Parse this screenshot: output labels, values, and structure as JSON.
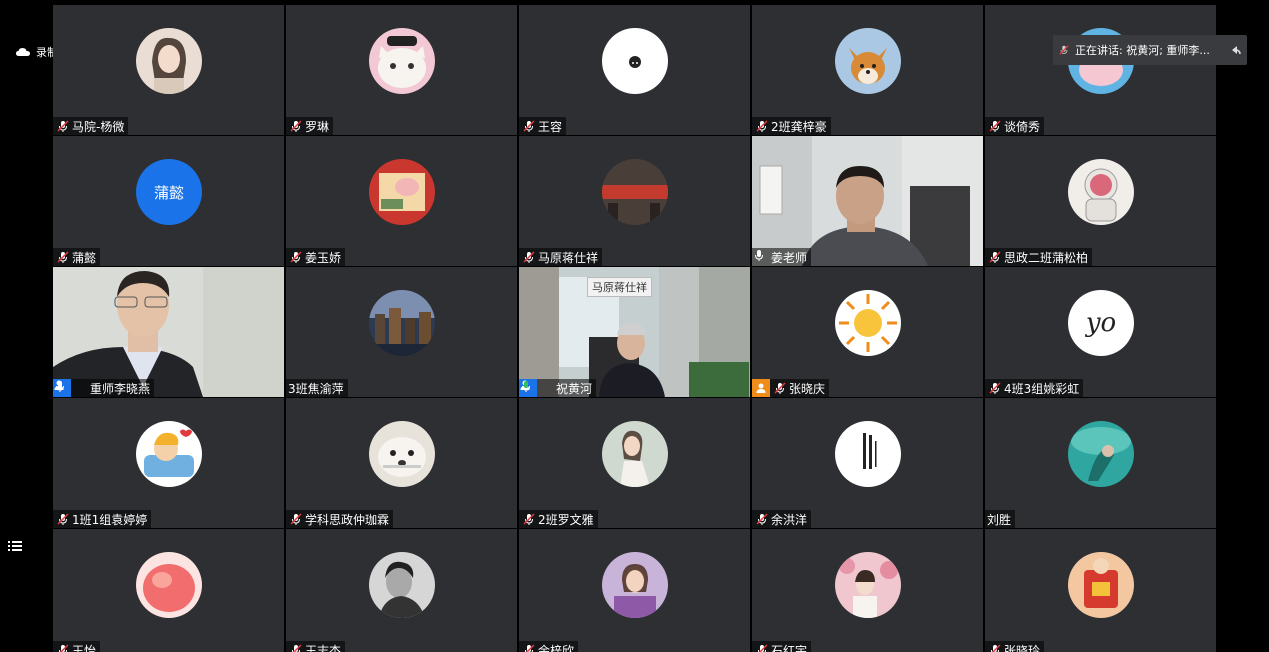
{
  "recording": {
    "label": "录制中"
  },
  "speaker_bar": {
    "text": "正在讲话: 祝黄河; 重师李..."
  },
  "participants": [
    {
      "name": "马院-杨微",
      "avatar": "photo-woman-icon"
    },
    {
      "name": "罗琳",
      "avatar": "cat-icon"
    },
    {
      "name": "王容",
      "avatar": "cartoon-face-icon"
    },
    {
      "name": "2班龚梓豪",
      "avatar": "shiba-dog-icon"
    },
    {
      "name": "谈倚秀",
      "avatar": "cartoon-illustration-icon"
    },
    {
      "name": "蒲懿",
      "avatar_text": "蒲懿",
      "avatar_color": "#1a73e8"
    },
    {
      "name": "姜玉娇",
      "avatar": "cartoon-pig-icon"
    },
    {
      "name": "马原蒋仕祥",
      "avatar": "banner-photo-icon"
    },
    {
      "name": "姜老师",
      "video": true
    },
    {
      "name": "思政二班蒲松柏",
      "avatar": "astronaut-icon"
    },
    {
      "name": "重师李晓燕",
      "video": true,
      "host": true
    },
    {
      "name": "3班焦渝萍",
      "avatar": "city-night-icon"
    },
    {
      "name": "祝黄河",
      "video": true,
      "host": true,
      "speaking": true,
      "tooltip": "马原蒋仕祥"
    },
    {
      "name": "张晓庆",
      "avatar": "sun-drawing-icon",
      "host": true
    },
    {
      "name": "4班3组姚彩虹",
      "avatar_text": "yo",
      "avatar_color": "#ffffff"
    },
    {
      "name": "1班1组袁婷婷",
      "avatar": "cartoon-boy-icon"
    },
    {
      "name": "学科思政仲珈霖",
      "avatar": "seal-icon"
    },
    {
      "name": "2班罗文雅",
      "avatar": "photo-woman-icon"
    },
    {
      "name": "余洪洋",
      "avatar": "calligraphy-icon"
    },
    {
      "name": "刘胜",
      "avatar": "underwater-icon"
    },
    {
      "name": "王怡",
      "avatar": "peach-icon"
    },
    {
      "name": "王志杰",
      "avatar": "bw-portrait-icon"
    },
    {
      "name": "余梓欣",
      "avatar": "photo-woman-icon"
    },
    {
      "name": "石红宇",
      "avatar": "photo-girl-icon"
    },
    {
      "name": "张晓玲",
      "avatar": "cartoon-red-icon"
    }
  ],
  "colors": {
    "tile_bg": "#2e2f33",
    "speaking_border": "#2fbf5f",
    "host_badge": "#1a73e8",
    "host_badge_alt": "#f08c1a",
    "active_mic": "#2fbf5f"
  }
}
